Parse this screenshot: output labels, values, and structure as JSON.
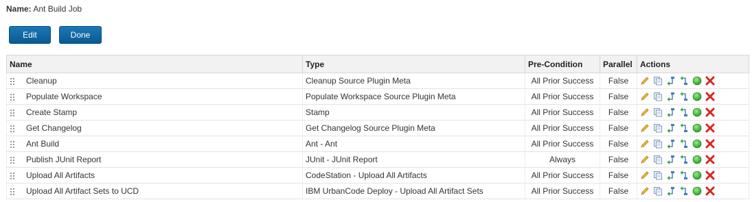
{
  "job": {
    "name_label": "Name:",
    "name_value": "Ant Build Job"
  },
  "toolbar": {
    "edit_label": "Edit",
    "done_label": "Done"
  },
  "table": {
    "headers": {
      "name": "Name",
      "type": "Type",
      "precondition": "Pre-Condition",
      "parallel": "Parallel",
      "actions": "Actions"
    },
    "rows": [
      {
        "name": "Cleanup",
        "type": "Cleanup Source Plugin Meta",
        "precondition": "All Prior Success",
        "parallel": "False"
      },
      {
        "name": "Populate Workspace",
        "type": "Populate Workspace Source Plugin Meta",
        "precondition": "All Prior Success",
        "parallel": "False"
      },
      {
        "name": "Create Stamp",
        "type": "Stamp",
        "precondition": "All Prior Success",
        "parallel": "False"
      },
      {
        "name": "Get Changelog",
        "type": "Get Changelog Source Plugin Meta",
        "precondition": "All Prior Success",
        "parallel": "False"
      },
      {
        "name": "Ant Build",
        "type": "Ant - Ant",
        "precondition": "All Prior Success",
        "parallel": "False"
      },
      {
        "name": "Publish JUnit Report",
        "type": "JUnit - JUnit Report",
        "precondition": "Always",
        "parallel": "False"
      },
      {
        "name": "Upload All Artifacts",
        "type": "CodeStation - Upload All Artifacts",
        "precondition": "All Prior Success",
        "parallel": "False"
      },
      {
        "name": "Upload All Artifact Sets to UCD",
        "type": "IBM UrbanCode Deploy - Upload All Artifact Sets",
        "precondition": "All Prior Success",
        "parallel": "False"
      }
    ],
    "row_actions": [
      "edit-pencil-icon",
      "copy-icon",
      "insert-before-icon",
      "insert-after-icon",
      "activate-green-circle-icon",
      "delete-red-x-icon"
    ]
  },
  "colors": {
    "button_blue": "#0a5a92",
    "header_bg": "#f2f2f2",
    "active_green": "#2eaa2e",
    "delete_red": "#d9241c"
  }
}
